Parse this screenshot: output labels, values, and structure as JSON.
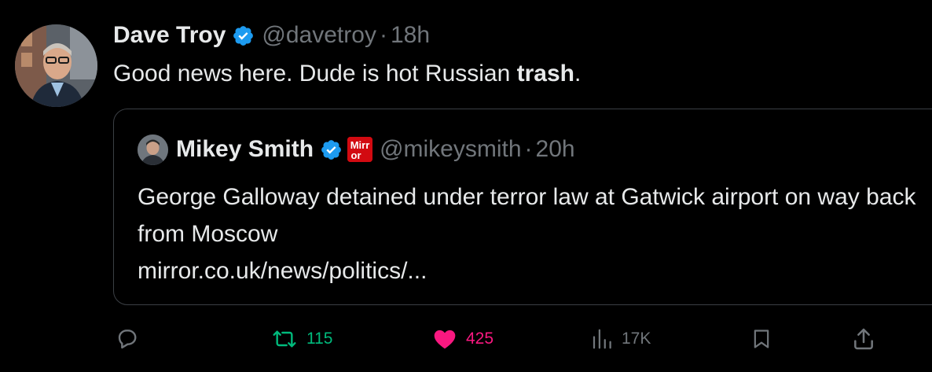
{
  "tweet": {
    "author_name": "Dave Troy",
    "handle": "@davetroy",
    "separator": "·",
    "time": "18h",
    "text_before": "Good news here. Dude is hot Russian ",
    "text_bold": "trash",
    "text_after": "."
  },
  "quote": {
    "author_name": "Mikey Smith",
    "badge_text": "Mirror",
    "handle": "@mikeysmith",
    "separator": "·",
    "time": "20h",
    "text": "George Galloway detained under terror law at Gatwick airport on way back from Moscow",
    "link": "mirror.co.uk/news/politics/..."
  },
  "actions": {
    "reply_icon": "reply-icon",
    "retweet_icon": "retweet-icon",
    "retweet_count": "115",
    "like_icon": "heart-icon",
    "like_count": "425",
    "views_icon": "views-icon",
    "views_count": "17K",
    "bookmark_icon": "bookmark-icon",
    "share_icon": "share-icon"
  },
  "colors": {
    "background": "#000000",
    "text": "#e7e9ea",
    "muted": "#71767b",
    "verified": "#1d9bf0",
    "retweet": "#00ba7c",
    "like": "#f91880",
    "mirror_red": "#d20a11"
  }
}
